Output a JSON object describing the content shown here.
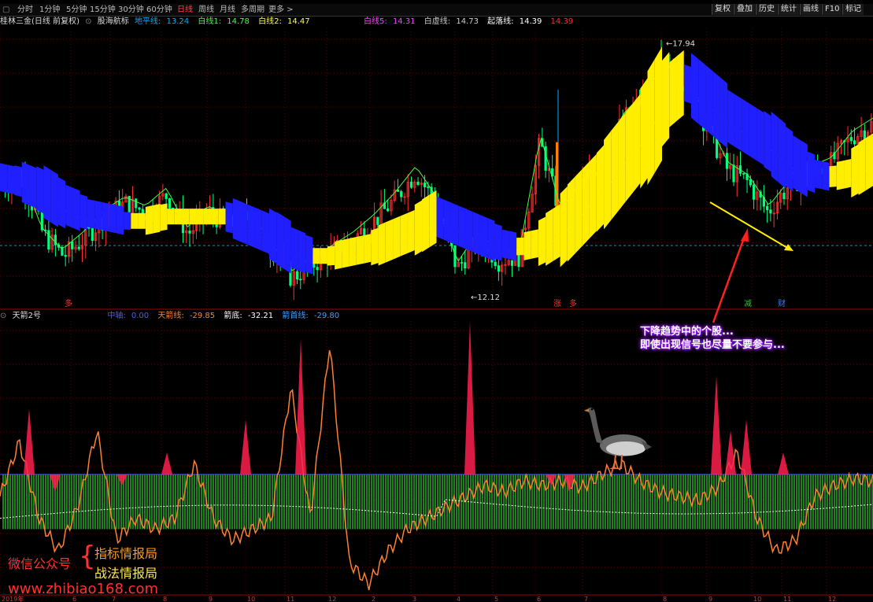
{
  "toolbar": {
    "tabs": [
      "分时",
      "1分钟",
      "5分钟",
      "15分钟",
      "30分钟",
      "60分钟",
      "日线",
      "周线",
      "月线",
      "多周期",
      "更多 >"
    ],
    "active_tab": "日线",
    "right_buttons": [
      "复权",
      "叠加",
      "历史",
      "统计",
      "画线",
      "F10",
      "标记"
    ]
  },
  "legend_top": {
    "stock": "桂林三金(日线 前复权)",
    "indicator": "股海航标",
    "items": [
      {
        "label": "地平线:",
        "value": "13.24",
        "color": "#00b0ff"
      },
      {
        "label": "白线1:",
        "value": "14.78",
        "color": "#40ff40"
      },
      {
        "label": "白线2:",
        "value": "14.47",
        "color": "#ffff40"
      },
      {
        "label": "白线5:",
        "value": "14.31",
        "color": "#ff40ff"
      },
      {
        "label": "白虚线:",
        "value": "14.73",
        "color": "#cccccc"
      },
      {
        "label": "起落线:",
        "value": "14.39",
        "color": "#ffffff"
      },
      {
        "label": "",
        "value": "14.39",
        "color": "#ff3030"
      }
    ]
  },
  "legend_bottom": {
    "indicator": "天箭2号",
    "items": [
      {
        "label": "中轴:",
        "value": "0.00",
        "color": "#4060ff"
      },
      {
        "label": "天箭线:",
        "value": "-29.85",
        "color": "#ff8030"
      },
      {
        "label": "箭底:",
        "value": "-32.21",
        "color": "#ffffff"
      },
      {
        "label": "箭首线:",
        "value": "-29.80",
        "color": "#40a0ff"
      }
    ]
  },
  "price_labels": {
    "high": "17.94",
    "low": "12.12"
  },
  "signals": [
    {
      "text": "多",
      "color": "#ff3030"
    },
    {
      "text": "涨",
      "color": "#ff3030"
    },
    {
      "text": "多",
      "color": "#ff3030"
    },
    {
      "text": "减",
      "color": "#30c030"
    },
    {
      "text": "财",
      "color": "#3080ff"
    }
  ],
  "annotation": [
    "下降趋势中的个股...",
    "即使出现信号也尽量不要参与..."
  ],
  "watermark": {
    "left": "微信公众号",
    "right1": "指标情报局",
    "right2": "战法情报局",
    "url": "www.zhibiao168.com"
  },
  "bottom_axis": [
    "2019年",
    "6",
    "7",
    "8",
    "9",
    "10",
    "11",
    "12",
    "2",
    "3",
    "4",
    "5",
    "6",
    "7",
    "8",
    "9",
    "10",
    "11",
    "12"
  ],
  "chart_data": {
    "type": "candlestick",
    "panes": [
      {
        "name": "price",
        "series": [
          {
            "name": "地平线",
            "values": [
              14.8,
              14.7,
              14.5,
              14.2,
              14.0,
              13.9,
              13.8,
              13.8,
              13.9,
              13.9,
              13.9,
              13.9,
              13.7,
              13.5,
              13.2,
              13.0,
              13.0,
              13.1,
              13.2,
              13.4,
              13.6,
              13.9,
              13.7,
              13.5,
              13.3,
              13.2,
              13.3,
              13.6,
              14.1,
              14.6,
              15.2,
              15.8,
              16.6,
              17.0,
              16.6,
              16.2,
              15.9,
              15.6,
              15.2,
              14.9,
              14.8,
              14.9,
              15.2
            ]
          },
          {
            "name": "close",
            "values": [
              14.6,
              14.8,
              13.5,
              13.0,
              13.4,
              13.9,
              14.2,
              14.0,
              14.4,
              13.5,
              14.0,
              13.7,
              13.9,
              13.2,
              12.5,
              12.8,
              13.1,
              13.4,
              13.8,
              14.3,
              14.9,
              14.2,
              12.7,
              13.4,
              12.9,
              13.0,
              15.6,
              13.9,
              14.6,
              15.2,
              16.1,
              16.6,
              17.2,
              17.0,
              16.0,
              15.0,
              14.7,
              14.0,
              14.6,
              14.9,
              15.1,
              15.7,
              16.0
            ]
          }
        ]
      },
      {
        "name": "天箭2号",
        "series": [
          {
            "name": "天箭线",
            "values": [
              -10,
              15,
              -20,
              -35,
              -15,
              20,
              -30,
              -20,
              -25,
              -20,
              5,
              -20,
              -30,
              -25,
              -20,
              40,
              -20,
              60,
              -40,
              -50,
              -35,
              -25,
              -20,
              -15,
              -10,
              -5,
              -8,
              -3,
              -5,
              -3,
              -6,
              0,
              5,
              -3,
              -8,
              -10,
              -12,
              -6,
              10,
              -20,
              -35,
              -30,
              -10,
              -5,
              -2,
              -3
            ]
          }
        ]
      }
    ]
  }
}
